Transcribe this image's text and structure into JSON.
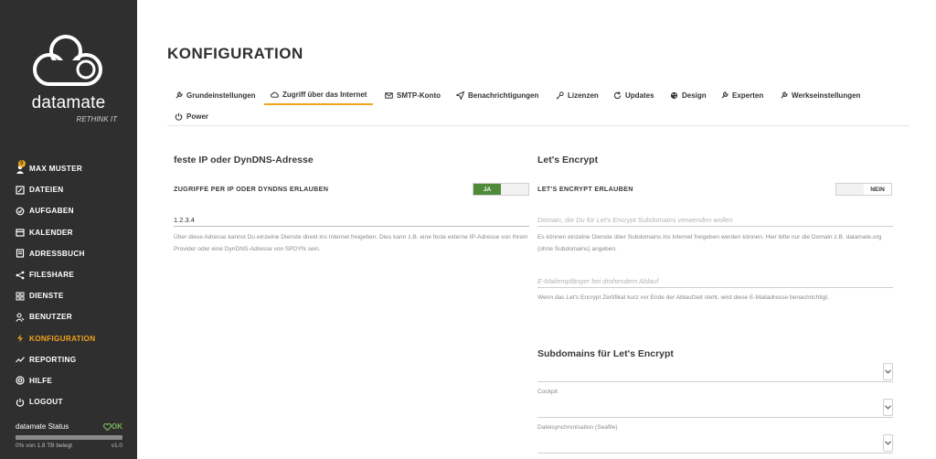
{
  "brand": {
    "name": "datamate",
    "tagline": "RETHINK IT"
  },
  "sidebar": {
    "badge": "0",
    "items": [
      {
        "label": "MAX MUSTER",
        "icon": "user-icon"
      },
      {
        "label": "DATEIEN",
        "icon": "edit-icon"
      },
      {
        "label": "AUFGABEN",
        "icon": "tasks-icon"
      },
      {
        "label": "KALENDER",
        "icon": "calendar-icon"
      },
      {
        "label": "ADRESSBUCH",
        "icon": "addressbook-icon"
      },
      {
        "label": "FILESHARE",
        "icon": "share-icon"
      },
      {
        "label": "DIENSTE",
        "icon": "grid-icon"
      },
      {
        "label": "BENUTZER",
        "icon": "users-icon"
      },
      {
        "label": "KONFIGURATION",
        "icon": "bolt-icon"
      },
      {
        "label": "REPORTING",
        "icon": "chart-icon"
      },
      {
        "label": "HILFE",
        "icon": "lifebuoy-icon"
      },
      {
        "label": "LOGOUT",
        "icon": "power-icon"
      }
    ],
    "status": {
      "title": "datamate Status",
      "ok": "OK",
      "usage": "0% von 1.8 TB belegt",
      "version": "v1.0",
      "usage_fraction": 0
    }
  },
  "page_title": "KONFIGURATION",
  "tabs": [
    {
      "label": "Grundeinstellungen",
      "icon": "wrench-icon"
    },
    {
      "label": "Zugriff über das Internet",
      "icon": "cloud-icon"
    },
    {
      "label": "SMTP-Konto",
      "icon": "mail-icon"
    },
    {
      "label": "Benachrichtigungen",
      "icon": "send-icon"
    },
    {
      "label": "Lizenzen",
      "icon": "key-icon"
    },
    {
      "label": "Updates",
      "icon": "refresh-icon"
    },
    {
      "label": "Design",
      "icon": "palette-icon"
    },
    {
      "label": "Experten",
      "icon": "wrench-icon"
    },
    {
      "label": "Werkseinstellungen",
      "icon": "wrench-icon"
    },
    {
      "label": "Power",
      "icon": "power-icon"
    }
  ],
  "left": {
    "title": "feste IP oder DynDNS-Adresse",
    "allow_label": "ZUGRIFFE PER IP ODER DYNDNS ERLAUBEN",
    "toggle_on": "JA",
    "address_value": "1.2.3.4",
    "help": "Über diese Adresse kannst Du einzelne Dienste direkt ins Internet freigeben. Dies kann z.B. eine feste externe IP-Adresse von Ihrem Provider oder eine DynDNS-Adresse von SPDYN sein."
  },
  "right": {
    "title": "Let's Encrypt",
    "allow_label": "LET'S ENCRYPT ERLAUBEN",
    "toggle_off": "NEIN",
    "domain_placeholder": "Domain, die Du für Let's Encrypt Subdomains verwenden wollen",
    "domain_help": "Es können einzelne Dienste über Subdomains ins Internet freigeben werden können. Hier bitte nur die Domain z.B. datamate.org (ohne Subdomains) angeben.",
    "email_placeholder": "E-Mailempfänger bei drohendem Ablauf",
    "email_help": "Wenn das Let's Encrypt Zertifikat kurz vor Ende der Ablaufzeit steht, wird diese E-Mailadresse benachrichtigt.",
    "subdomains_title": "Subdomains für Let's Encrypt",
    "subdomain_labels": [
      "Cockpit",
      "Dateisynchronisation (Seafile)"
    ]
  }
}
